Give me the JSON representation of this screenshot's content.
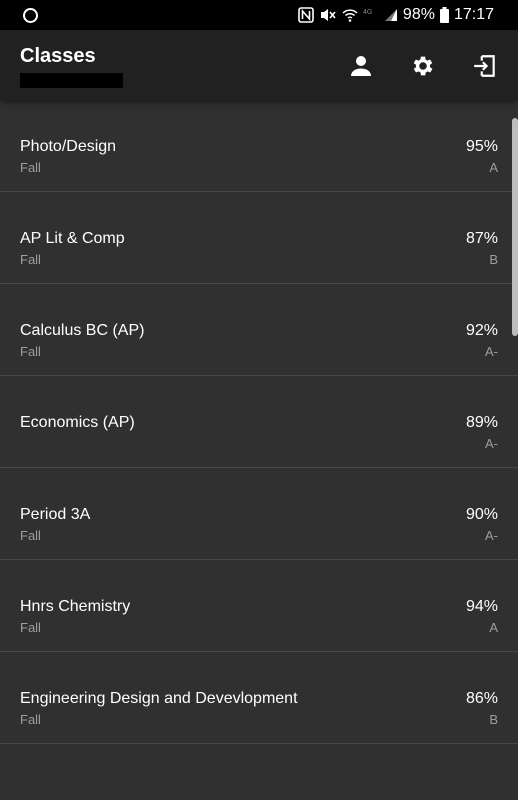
{
  "status_bar": {
    "battery": "98%",
    "time": "17:17",
    "icons": [
      "nfc-icon",
      "mute-icon",
      "wifi-icon",
      "4g-icon",
      "signal-icon",
      "battery-icon"
    ]
  },
  "app_bar": {
    "title": "Classes",
    "actions": [
      "person-icon",
      "gear-icon",
      "logout-icon"
    ]
  },
  "classes": [
    {
      "name": "Photo/Design",
      "term": "Fall",
      "percent": "95%",
      "letter": "A"
    },
    {
      "name": "AP Lit & Comp",
      "term": "Fall",
      "percent": "87%",
      "letter": "B"
    },
    {
      "name": "Calculus BC (AP)",
      "term": "Fall",
      "percent": "92%",
      "letter": "A-"
    },
    {
      "name": "Economics (AP)",
      "term": "",
      "percent": "89%",
      "letter": "A-"
    },
    {
      "name": "Period 3A",
      "term": "Fall",
      "percent": "90%",
      "letter": "A-"
    },
    {
      "name": "Hnrs Chemistry",
      "term": "Fall",
      "percent": "94%",
      "letter": "A"
    },
    {
      "name": "Engineering Design and Devevlopment",
      "term": "Fall",
      "percent": "86%",
      "letter": "B"
    }
  ],
  "colors": {
    "background": "#303030",
    "app_bar": "#212121",
    "status_bar": "#000000",
    "text_primary": "#ffffff",
    "text_secondary": "#9e9e9e",
    "divider": "#474747"
  }
}
